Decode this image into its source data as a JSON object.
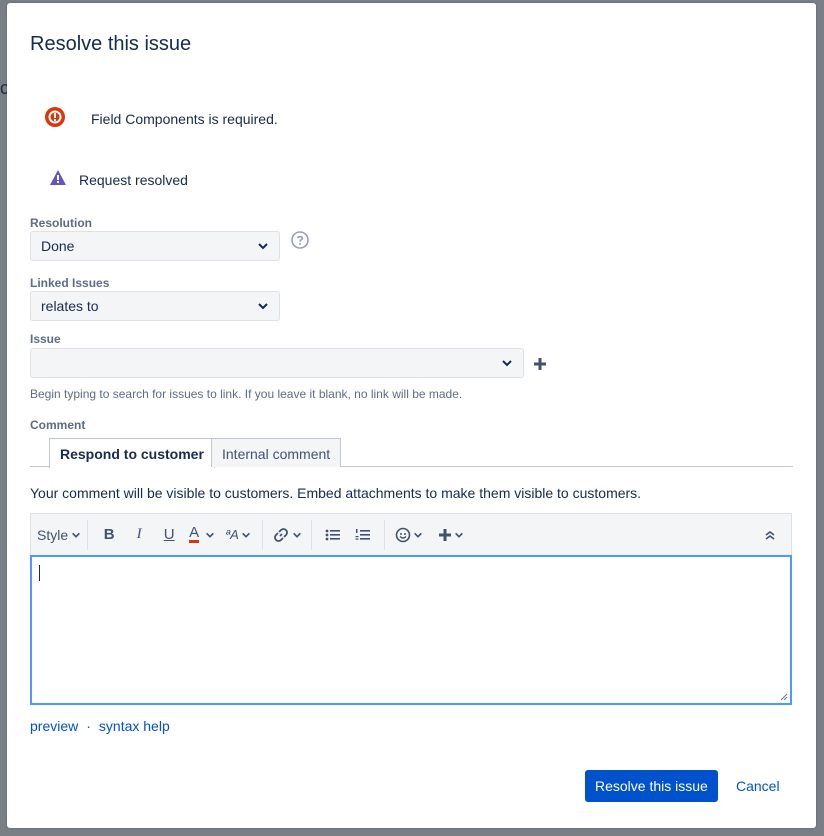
{
  "dialog": {
    "title": "Resolve this issue",
    "error_message": "Field Components is required.",
    "warning_message": "Request resolved"
  },
  "fields": {
    "resolution": {
      "label": "Resolution",
      "value": "Done"
    },
    "linked_issues": {
      "label": "Linked Issues",
      "value": "relates to"
    },
    "issue": {
      "label": "Issue",
      "value": "",
      "hint": "Begin typing to search for issues to link. If you leave it blank, no link will be made."
    }
  },
  "comment": {
    "label": "Comment",
    "tabs": [
      {
        "label": "Respond to customer",
        "active": true
      },
      {
        "label": "Internal comment",
        "active": false
      }
    ],
    "visibility_note": "Your comment will be visible to customers. Embed attachments to make them visible to customers.",
    "toolbar": {
      "style_label": "Style",
      "bold_label": "B",
      "italic_label": "I",
      "underline_label": "U",
      "text_color_label": "A",
      "text_effects_label": "ªA"
    },
    "text": "",
    "preview_link": "preview",
    "separator": "·",
    "syntax_help_link": "syntax help"
  },
  "actions": {
    "submit_label": "Resolve this issue",
    "cancel_label": "Cancel"
  },
  "colors": {
    "primary": "#0052cc",
    "error": "#de350b",
    "warning": "#6554c0",
    "focus": "#4c9aff"
  }
}
